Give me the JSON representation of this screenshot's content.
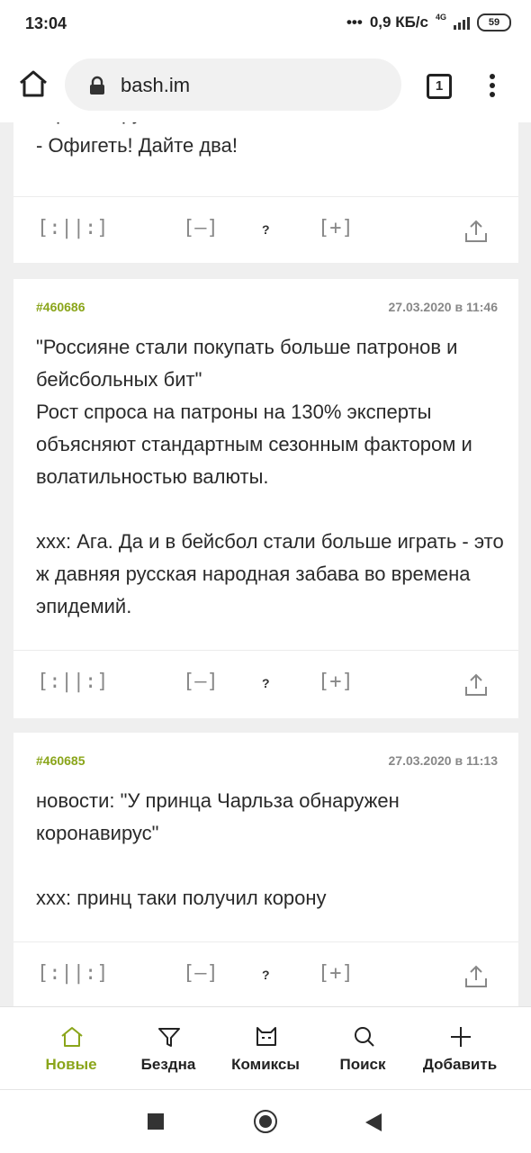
{
  "status": {
    "time": "13:04",
    "network_speed": "0,9 КБ/с",
    "network_type": "4G",
    "battery": "59"
  },
  "browser": {
    "url": "bash.im",
    "tab_count": "1"
  },
  "feed": {
    "partial_card": {
      "text": "коронавирус...\n- Офигеть! Дайте два!"
    },
    "cards": [
      {
        "id": "#460686",
        "date": "27.03.2020 в 11:46",
        "text": "\"Россияне стали покупать больше патронов и бейсбольных бит\"\nРост спроса на патроны на 130% эксперты объясняют стандартным сезонным фактором и волатильностью валюты.\n\nxxx: Ага. Да и в бейсбол стали больше играть - это ж давняя русская народная забава во времена эпидемий."
      },
      {
        "id": "#460685",
        "date": "27.03.2020 в 11:13",
        "text": "новости: \"У принца Чарльза обнаружен коронавирус\"\n\nxxx: принц таки получил корону"
      }
    ],
    "actions": {
      "bayan": "[:||:]",
      "minus": "[–]",
      "rating": "?",
      "plus": "[+]",
      "share_icon": "share-icon"
    }
  },
  "tabbar": {
    "items": [
      {
        "label": "Новые",
        "icon": "home-icon",
        "active": true
      },
      {
        "label": "Бездна",
        "icon": "funnel-icon",
        "active": false
      },
      {
        "label": "Комиксы",
        "icon": "cat-icon",
        "active": false
      },
      {
        "label": "Поиск",
        "icon": "search-icon",
        "active": false
      },
      {
        "label": "Добавить",
        "icon": "plus-icon",
        "active": false
      }
    ],
    "accent": "#8aa51a"
  }
}
